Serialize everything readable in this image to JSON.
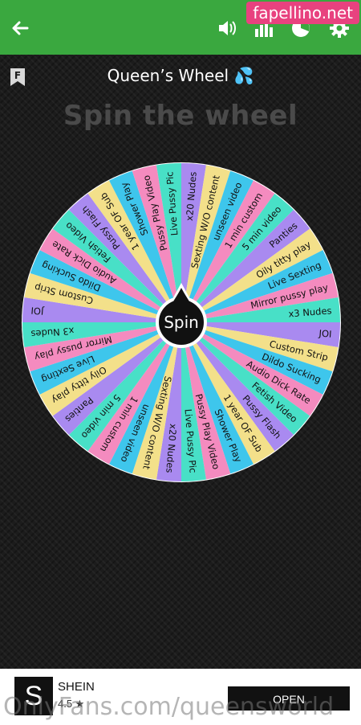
{
  "watermark": "fapellino.net",
  "header": {
    "icons": [
      "back-arrow-icon",
      "sound-icon",
      "stats-icon",
      "pie-chart-icon",
      "settings-gear-icon"
    ],
    "flag_letter": "F",
    "title": "Queen’s Wheel 💦",
    "subtitle": "Spin the wheel"
  },
  "wheel": {
    "spin_label": "Spin",
    "segments": [
      "x20 Nudes",
      "Sexting W/O content",
      "unseen video",
      "1 min custom",
      "5 min video",
      "Panties",
      "Oily titty play",
      "Live Sexting",
      "Mirror pussy play",
      "x3 Nudes",
      "JOI",
      "Custom Strip",
      "Dildo Sucking",
      "Audio Dick Rate",
      "Fetish Video",
      "Pussy Flash",
      "1 year OF Sub",
      "Shower Play",
      "Pussy Play Video",
      "Live Pussy Pic",
      "x20 Nudes",
      "Sexting W/O content",
      "unseen video",
      "1 min custom",
      "5 min video",
      "Panties",
      "Oily titty play",
      "Live Sexting",
      "Mirror pussy play",
      "x3 Nudes",
      "JOI",
      "Custom Strip",
      "Dildo Sucking",
      "Audio Dick Rate",
      "Fetish Video",
      "Pussy Flash",
      "1 year OF Sub",
      "Shower Play",
      "Pussy Play Video",
      "Live Pussy Pic"
    ],
    "colors": [
      "#a98af0",
      "#f3e08a",
      "#3ec6ec",
      "#f48bbf",
      "#48e0c7"
    ]
  },
  "ad": {
    "logo_letter": "S",
    "name": "SHEIN",
    "rating": "4.5 ★",
    "button": "OPEN",
    "watermark": "OnlyFans.com/queensworld"
  }
}
